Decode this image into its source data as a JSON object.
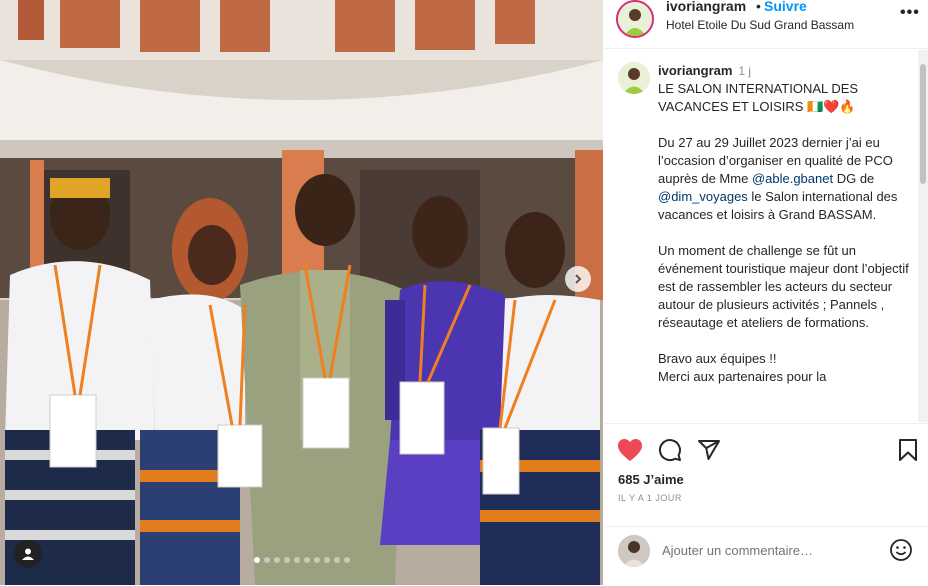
{
  "post": {
    "username": "ivoriangram",
    "follow_label": "Suivre",
    "separator": "•",
    "location": "Hotel Etoile Du Sud Grand Bassam",
    "more_label": "•••"
  },
  "caption": {
    "username": "ivoriangram",
    "time": "1 j",
    "line_1": "LE SALON INTERNATIONAL DES VACANCES ET LOISIRS 🇨🇮❤️🔥",
    "para_2_a": "Du 27 au 29 Juillet 2023 dernier j’ai eu l’occasion d’organiser en qualité de PCO auprès de Mme ",
    "mention_1": "@able.gbanet",
    "para_2_b": " DG de ",
    "mention_2": "@dim_voyages",
    "para_2_c": " le Salon international des vacances et loisirs à Grand BASSAM.",
    "para_3": "Un moment de challenge se fût un événement touristique majeur dont l’objectif est de rassembler les acteurs du secteur autour de plusieurs activités ; Pannels , réseautage et ateliers de formations.",
    "para_4": "Bravo aux équipes !!\nMerci aux partenaires pour la"
  },
  "actions": {
    "likes": "685 J’aime",
    "ago": "IL Y A 1 JOUR"
  },
  "comment_box": {
    "placeholder": "Ajouter un commentaire…"
  },
  "carousel": {
    "slide_count": 10,
    "active_index": 0
  },
  "colors": {
    "like": "#ed4956",
    "follow": "#0095f6",
    "mention": "#00376b"
  }
}
